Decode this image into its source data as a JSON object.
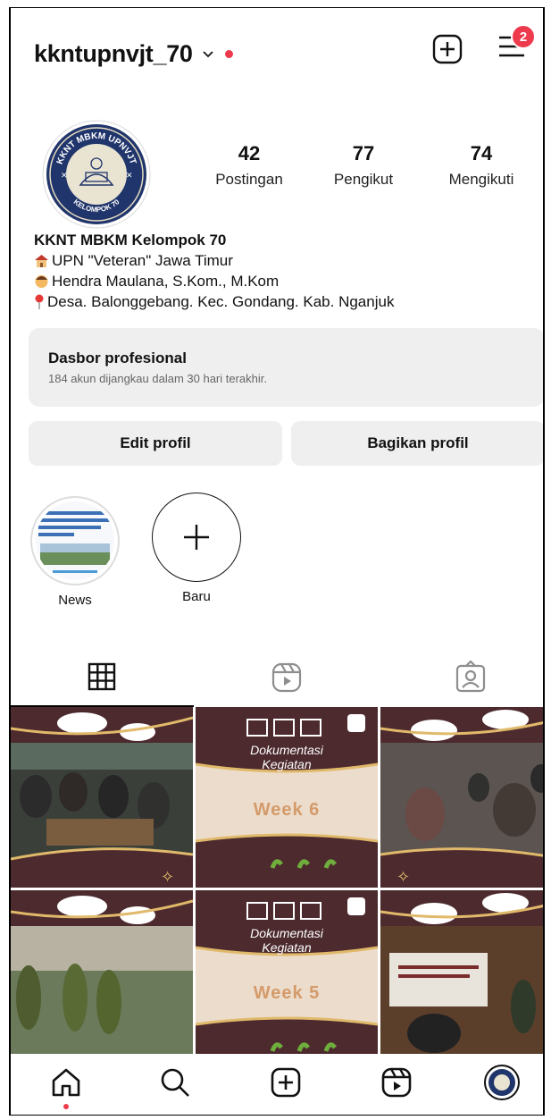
{
  "header": {
    "username": "kkntupnvjt_70",
    "notification_count": "2"
  },
  "stats": [
    {
      "value": "42",
      "label": "Postingan"
    },
    {
      "value": "77",
      "label": "Pengikut"
    },
    {
      "value": "74",
      "label": "Mengikuti"
    }
  ],
  "avatar_logo": {
    "top_text": "KKNT MBKM UPNVJT",
    "bottom_text": "KELOMPOK 70"
  },
  "bio": {
    "name": "KKNT MBKM Kelompok 70",
    "line1": "UPN \"Veteran\" Jawa Timur",
    "line2": "Hendra Maulana, S.Kom., M.Kom",
    "line3": "Desa. Balonggebang. Kec. Gondang. Kab. Nganjuk"
  },
  "dashboard": {
    "title": "Dasbor profesional",
    "subtitle": "184 akun dijangkau dalam 30 hari terakhir."
  },
  "buttons": {
    "edit": "Edit profil",
    "share": "Bagikan profil"
  },
  "highlights": [
    {
      "label": "News"
    },
    {
      "label": "Baru"
    }
  ],
  "posts": [
    {
      "type": "photo"
    },
    {
      "type": "cover",
      "title": "Dokumentasi",
      "subtitle": "Kegiatan",
      "week": "Week 6"
    },
    {
      "type": "photo"
    },
    {
      "type": "photo"
    },
    {
      "type": "cover",
      "title": "Dokumentasi",
      "subtitle": "Kegiatan",
      "week": "Week 5"
    },
    {
      "type": "photo"
    }
  ],
  "colors": {
    "brand_maroon": "#4c2a2e",
    "cream": "#ecdccb",
    "accent_red": "#ed3b4d"
  }
}
